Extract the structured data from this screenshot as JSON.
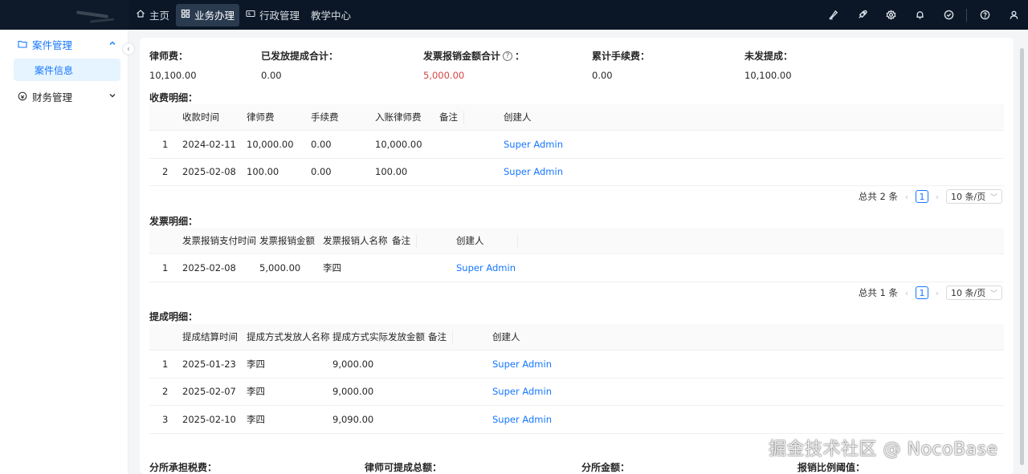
{
  "topnav": {
    "items": [
      {
        "label": "主页",
        "icon": "home-icon"
      },
      {
        "label": "业务办理",
        "icon": "grid-icon"
      },
      {
        "label": "行政管理",
        "icon": "id-card-icon"
      },
      {
        "label": "教学中心",
        "icon": ""
      }
    ],
    "active_index": 1,
    "right_icons": [
      "brush-icon",
      "rocket-icon",
      "gear-icon",
      "bell-icon",
      "check-circle-icon",
      "help-icon",
      "user-icon"
    ]
  },
  "sidebar": {
    "groups": [
      {
        "label": "案件管理",
        "icon": "folder-icon",
        "expanded": true,
        "children": [
          {
            "label": "案件信息"
          }
        ]
      },
      {
        "label": "财务管理",
        "icon": "finance-icon",
        "expanded": false
      }
    ]
  },
  "summary": [
    {
      "label": "律师费：",
      "value": "10,100.00"
    },
    {
      "label": "已发放提成合计：",
      "value": "0.00"
    },
    {
      "label": "发票报销金额合计",
      "label_suffix": "：",
      "value": "5,000.00",
      "has_help": true,
      "value_color": "#d64545"
    },
    {
      "label": "累计手续费：",
      "value": "0.00"
    },
    {
      "label": "未发提成：",
      "value": "10,100.00"
    }
  ],
  "fees": {
    "title": "收费明细：",
    "columns": [
      "收款时间",
      "律师费",
      "手续费",
      "入账律师费",
      "备注",
      "创建人"
    ],
    "rows": [
      {
        "no": "1",
        "date": "2024-02-11",
        "fee": "10,000.00",
        "charge": "0.00",
        "net": "10,000.00",
        "note": "",
        "creator": "Super Admin"
      },
      {
        "no": "2",
        "date": "2025-02-08",
        "fee": "100.00",
        "charge": "0.00",
        "net": "100.00",
        "note": "",
        "creator": "Super Admin"
      }
    ],
    "pagination": {
      "total": "总共 2 条",
      "page": "1",
      "size": "10 条/页"
    }
  },
  "invoices": {
    "title": "发票明细：",
    "columns": [
      "发票报销支付时间",
      "发票报销金额",
      "发票报销人名称",
      "备注",
      "创建人"
    ],
    "rows": [
      {
        "no": "1",
        "date": "2025-02-08",
        "amount": "5,000.00",
        "name": "李四",
        "note": "",
        "creator": "Super Admin"
      }
    ],
    "pagination": {
      "total": "总共 1 条",
      "page": "1",
      "size": "10 条/页"
    }
  },
  "commissions": {
    "title": "提成明细：",
    "columns": [
      "提成结算时间",
      "提成方式发放人名称",
      "提成方式实际发放金额",
      "备注",
      "创建人"
    ],
    "rows": [
      {
        "no": "1",
        "date": "2025-01-23",
        "name": "李四",
        "amount": "9,000.00",
        "note": "",
        "creator": "Super Admin"
      },
      {
        "no": "2",
        "date": "2025-02-07",
        "name": "李四",
        "amount": "9,000.00",
        "note": "",
        "creator": "Super Admin"
      },
      {
        "no": "3",
        "date": "2025-02-10",
        "name": "李四",
        "amount": "9,090.00",
        "note": "",
        "creator": "Super Admin"
      }
    ]
  },
  "footer": [
    "分所承担税费：",
    "律师可提成总额：",
    "分所金额：",
    "报销比例阈值："
  ],
  "watermark": "掘金技术社区 @ NocoBase"
}
